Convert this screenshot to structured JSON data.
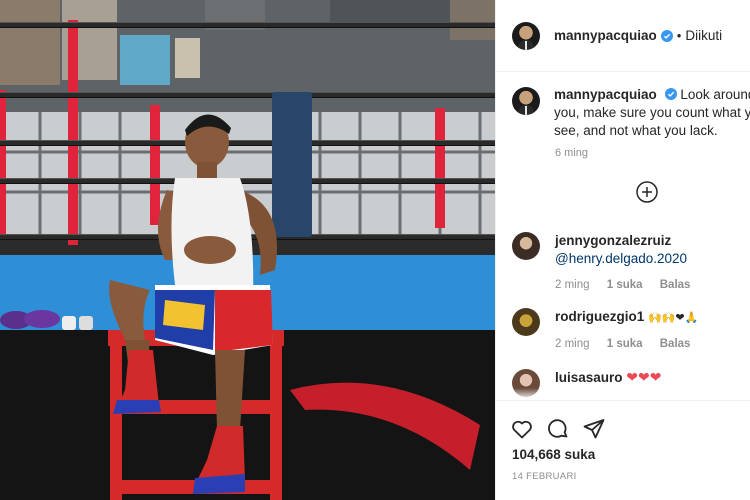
{
  "post": {
    "username": "mannypacquiao",
    "follow_status": "Diikuti",
    "dot": "•",
    "caption": "Look around you, make sure you count what you see, and not what you lack.",
    "time_ago": "6 ming",
    "likes": "104,668 suka",
    "date": "14 FEBRUARI"
  },
  "comments": [
    {
      "username": "jennygonzalezruiz",
      "text": "@henry.delgado.2020",
      "time": "2 ming",
      "likes": "1 suka",
      "reply": "Balas"
    },
    {
      "username": "rodriguezgio1",
      "text": "🙌🙌❤🙏",
      "time": "2 ming",
      "likes": "1 suka",
      "reply": "Balas"
    },
    {
      "username": "luisasauro",
      "text": "❤❤❤"
    }
  ],
  "icons": {
    "like": "heart-icon",
    "comment": "comment-icon",
    "share": "send-icon",
    "verified": "verified-badge-icon",
    "more": "load-more-icon"
  },
  "colors": {
    "verified": "#3897f0",
    "heart": "#ed4956",
    "muted": "#8e8e8e"
  }
}
